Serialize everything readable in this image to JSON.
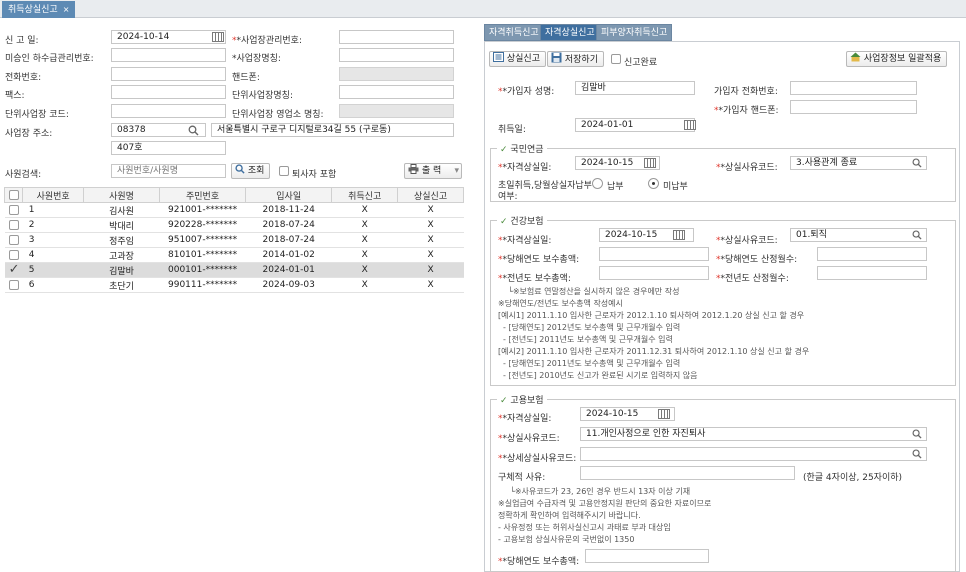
{
  "tab": {
    "title": "취득상실신고",
    "close": "×"
  },
  "left": {
    "report_date_label": "신 고 일:",
    "report_date": "2024-10-14",
    "biz_mgmt_no_label": "*사업장관리번호:",
    "unpaid_label": "미승인 하수급관리번호:",
    "biz_name_label": "*사업장명칭:",
    "phone_label": "전화번호:",
    "mobile_label": "핸드폰:",
    "fax_label": "팩스:",
    "unit_biz_name_label": "단위사업장명칭:",
    "unit_biz_code_label": "단위사업장 코드:",
    "unit_biz_office_label": "단위사업장 영업소 명칭:",
    "address_label": "사업장 주소:",
    "zip": "08378",
    "address1": "서울특별시 구로구 디지털로34길 55 (구로동)",
    "address2": "407호",
    "search_label": "사원검색:",
    "search_placeholder": "사원번호/사원명",
    "search_button": "조회",
    "include_retired": "퇴사자 포함",
    "print_button": "출 력"
  },
  "table": {
    "headers": [
      "사원번호",
      "사원명",
      "주민번호",
      "입사일",
      "취득신고",
      "상실신고"
    ],
    "rows": [
      {
        "no": "1",
        "name": "김사원",
        "rrn": "921001-*******",
        "hire": "2018-11-24",
        "acq": "X",
        "loss": "X",
        "selected": false
      },
      {
        "no": "2",
        "name": "박대리",
        "rrn": "920228-*******",
        "hire": "2018-07-24",
        "acq": "X",
        "loss": "X",
        "selected": false
      },
      {
        "no": "3",
        "name": "정주임",
        "rrn": "951007-*******",
        "hire": "2018-07-24",
        "acq": "X",
        "loss": "X",
        "selected": false
      },
      {
        "no": "4",
        "name": "고과장",
        "rrn": "810101-*******",
        "hire": "2014-01-02",
        "acq": "X",
        "loss": "X",
        "selected": false
      },
      {
        "no": "5",
        "name": "김말바",
        "rrn": "000101-*******",
        "hire": "2024-01-01",
        "acq": "X",
        "loss": "X",
        "selected": true
      },
      {
        "no": "6",
        "name": "초단기",
        "rrn": "990111-*******",
        "hire": "2024-09-03",
        "acq": "X",
        "loss": "X",
        "selected": false
      }
    ]
  },
  "right": {
    "tabs": [
      "자격취득신고",
      "자격상실신고",
      "피부양자취득신고"
    ],
    "loss_report_button": "상실신고",
    "save_button": "저장하기",
    "report_done": "신고완료",
    "apply_button": "사업장정보 일괄적용",
    "subscriber_name_label": "*가입자 성명:",
    "subscriber_name": "김말바",
    "subscriber_phone_label": "가입자 전화번호:",
    "subscriber_mobile_label": "*가입자 핸드폰:",
    "acq_date_label": "취득일:",
    "acq_date": "2024-01-01",
    "pension": {
      "title": "국민연금",
      "loss_date_label": "*자격상실일:",
      "loss_date": "2024-10-15",
      "reason_label": "*상실사유코드:",
      "reason": "3.사용관계 종료",
      "first_label_1": "초일취득,당월상실자납부",
      "first_label_2": "여부:",
      "pay": "납부",
      "nopay": "미납부"
    },
    "health": {
      "title": "건강보험",
      "loss_date_label": "*자격상실일:",
      "loss_date": "2024-10-15",
      "reason_label": "*상실사유코드:",
      "reason": "01.퇴직",
      "cur_pay_label": "*당해연도 보수총액:",
      "cur_months_label": "*당해연도 산정월수:",
      "prev_pay_label": "*전년도 보수총액:",
      "prev_months_label": "*전년도 산정월수:",
      "notes": [
        "└※보험료 연말정산을 실시하지 않은 경우에만 작성",
        "※당해연도/전년도 보수총액 작성예시",
        "[예시1] 2011.1.10 입사한 근로자가 2012.1.10 퇴사하여 2012.1.20 상실 신고 할 경우",
        " - [당해연도] 2012년도 보수총액 및 근무개월수 입력",
        " - [전년도] 2011년도 보수총액 및 근무개월수 입력",
        "[예시2] 2011.1.10 입사한 근로자가 2011.12.31 퇴사하여 2012.1.10 상실 신고 할 경우",
        " - [당해연도] 2011년도 보수총액 및 근무개월수 입력",
        " - [전년도] 2010년도 신고가 완료된 시기로 입력하지 않음"
      ]
    },
    "employment": {
      "title": "고용보험",
      "loss_date_label": "*자격상실일:",
      "loss_date": "2024-10-15",
      "reason_label": "*상실사유코드:",
      "reason": "11.개인사정으로 인한 자진퇴사",
      "detail_label": "*상세상실사유코드:",
      "specific_label": "구체적 사유:",
      "specific_hint": "(한글 4자이상, 25자이하)",
      "notes": [
        "└※사유코드가 23, 26인 경우 반드시 13자 이상 기재",
        "※실업급여 수급자격 및 고용안정지원 판단의 중요한 자료이므로",
        "  정확하게 확인하여 입력해주시기 바랍니다.",
        " - 사유정정 또는 허위사실신고시 과태료 부과 대상임",
        " - 고용보험 상실사유문의 국번없이 1350"
      ],
      "cur_pay_label": "*당해연도 보수총액:"
    }
  },
  "colors": {
    "accent": "#3f6f9f",
    "tab_inactive": "#7d97b0",
    "required": "#e0352b"
  }
}
